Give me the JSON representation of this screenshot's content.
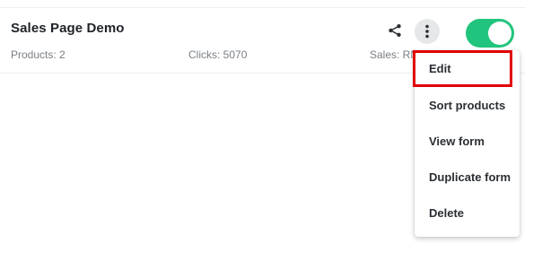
{
  "card": {
    "title": "Sales Page Demo",
    "products": "Products: 2",
    "clicks": "Clicks: 5070",
    "sales": "Sales: RM"
  },
  "actions": {
    "share_icon": "share-icon",
    "more_icon": "more-vertical-icon",
    "toggle_state": "on",
    "toggle_color": "#21c47c"
  },
  "menu": {
    "items": [
      {
        "label": "Edit",
        "highlighted": true
      },
      {
        "label": "Sort products"
      },
      {
        "label": "View form"
      },
      {
        "label": "Duplicate form"
      },
      {
        "label": "Delete"
      }
    ],
    "highlight_color": "#e10000"
  }
}
